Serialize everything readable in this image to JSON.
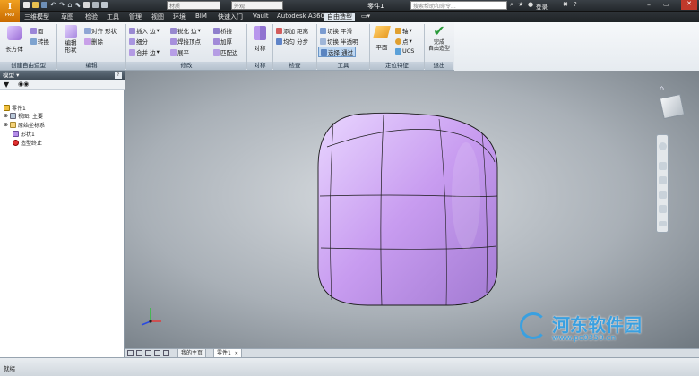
{
  "titlebar": {
    "app_badge": "PRO",
    "font_combo": "材质",
    "appearance_combo": "外观",
    "doc_title": "零件1",
    "search_placeholder": "搜索帮助和命令...",
    "login": "登录"
  },
  "menu": [
    "三维模型",
    "草图",
    "检验",
    "工具",
    "管理",
    "视图",
    "环境",
    "BIM",
    "快速入门",
    "Vault",
    "Autodesk A360",
    "自由造型"
  ],
  "menu_active_index": 11,
  "ribbon": {
    "create_panel": {
      "label": "创建自由造型",
      "box_button": "长方体",
      "face_button": "面",
      "convert_button": "转换"
    },
    "edit_panel": {
      "label": "编辑",
      "edit_form_button": "编辑\n形状",
      "align_form_button": "对齐 形状",
      "delete_button": "删除"
    },
    "modify_panel": {
      "label": "修改",
      "insert_edge": "插入 边",
      "subdivide": "细分",
      "merge_edge": "合并 边",
      "crease_edge": "锐化 边",
      "weld_vertex": "焊接顶点",
      "flatten": "展平",
      "bridge": "桥接",
      "thicken": "加厚",
      "match_edge": "匹配边"
    },
    "symmetry_panel": {
      "label": "对称",
      "symmetry_button": "对称"
    },
    "inspect_panel": {
      "label": "检查",
      "add_distance": "添加 距离",
      "uniform_distribute": "均匀 分步"
    },
    "tools_panel": {
      "label": "工具",
      "toggle_smooth": "切换 平滑",
      "toggle_transparent": "切换 半透明",
      "select_through": "选择 通过"
    },
    "workfeature_panel": {
      "label": "定位特征",
      "plane_button": "平面",
      "axis_button": "轴",
      "point_button": "点",
      "ucs_button": "UCS"
    },
    "exit_panel": {
      "label": "退出",
      "finish_button": "完成\n自由造型"
    }
  },
  "browser": {
    "header": "模型",
    "tree": [
      {
        "label": "零件1",
        "level": 0
      },
      {
        "label": "视图: 主要",
        "level": 1
      },
      {
        "label": "原始坐标系",
        "level": 1
      },
      {
        "label": "形状1",
        "level": 1
      },
      {
        "label": "造型终止",
        "level": 1
      }
    ]
  },
  "tabs": {
    "home_tab": "我的主页",
    "doc_tab": "零件1"
  },
  "status": {
    "text": "就绪"
  },
  "watermark": {
    "title": "河东软件园",
    "url": "www.pc0359.cn"
  },
  "colors": {
    "accent": "#3aa0e0",
    "shape": "#c89cf0",
    "viewport": "#a9b0b7"
  }
}
